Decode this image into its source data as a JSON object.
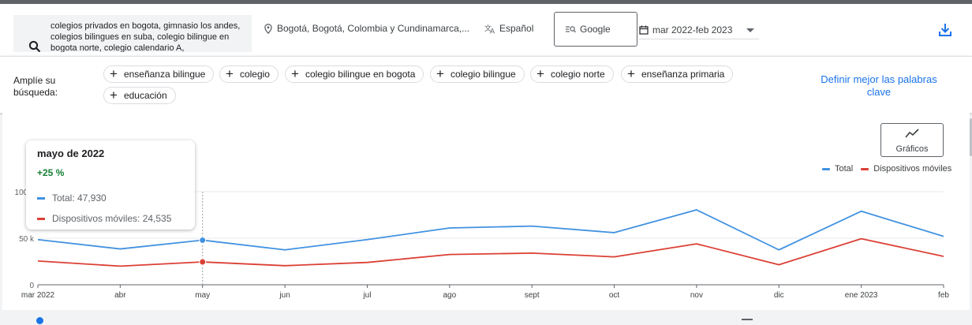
{
  "toolbar": {
    "search_text": "colegios privados en bogota, gimnasio los andes, colegios bilingues en suba, colegio bilingue en bogota norte, colegio calendario A,",
    "location": "Bogotá, Bogotá, Colombia y Cundinamarca,...",
    "language": "Español",
    "engine": "Google",
    "date_range": "mar 2022-feb 2023"
  },
  "refine": {
    "label": "Amplíe su búsqueda:",
    "chips": [
      "enseñanza bilingue",
      "colegio",
      "colegio bilingue en bogota",
      "colegio bilingue",
      "colegio norte",
      "enseñanza primaria",
      "educación"
    ],
    "link": "Definir mejor las palabras clave"
  },
  "chart_controls": {
    "charts_button": "Gráficos"
  },
  "tooltip": {
    "title": "mayo de 2022",
    "change": "+25 %",
    "total_label": "Total: 47,930",
    "mobile_label": "Dispositivos móviles: 24,535"
  },
  "colors": {
    "total": "#4292e0",
    "mobile": "#db4035",
    "link": "#1a73e8",
    "positive": "#188038"
  },
  "icons": [
    "search-icon",
    "location-pin-icon",
    "translate-icon",
    "search-engine-icon",
    "calendar-icon",
    "chevron-down-icon",
    "download-icon",
    "add-icon",
    "trend-chart-icon"
  ],
  "chart_data": {
    "type": "line",
    "categories": [
      "mar 2022",
      "abr",
      "may",
      "jun",
      "jul",
      "ago",
      "sept",
      "oct",
      "nov",
      "dic",
      "ene 2023",
      "feb"
    ],
    "series": [
      {
        "name": "Total",
        "values": [
          48500,
          38500,
          47930,
          37500,
          48500,
          61000,
          63000,
          56000,
          80500,
          37500,
          79000,
          52000
        ]
      },
      {
        "name": "Dispositivos móviles",
        "values": [
          25500,
          20000,
          24535,
          20500,
          24000,
          32500,
          34000,
          30000,
          44000,
          21500,
          49500,
          30500
        ]
      }
    ],
    "y_ticks": [
      "0",
      "50 k",
      "100 k"
    ],
    "ylim": [
      0,
      100000
    ],
    "highlight_index": 2,
    "legend_position": "top-right"
  }
}
